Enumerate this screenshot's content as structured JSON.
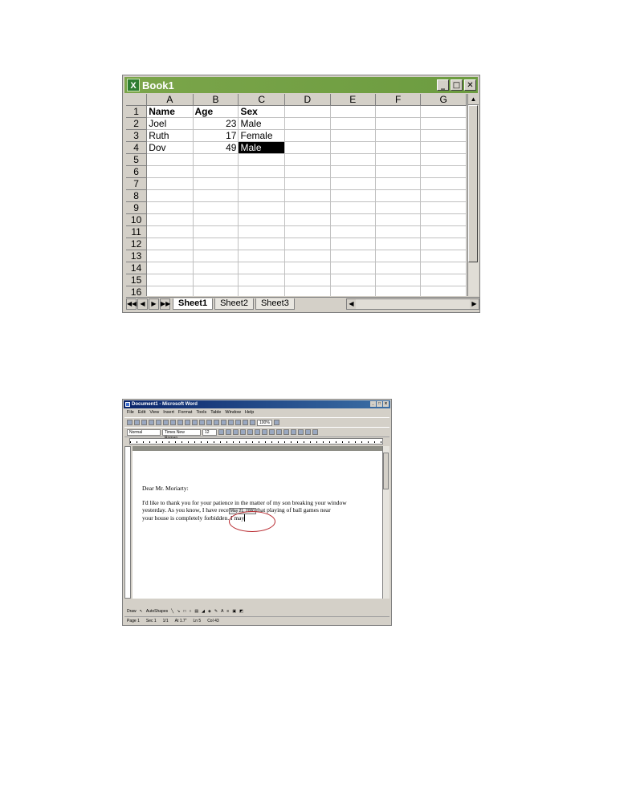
{
  "excel": {
    "title": "Book1",
    "icon": "excel-app-icon",
    "columns": [
      "A",
      "B",
      "C",
      "D",
      "E",
      "F",
      "G"
    ],
    "row_numbers": [
      "1",
      "2",
      "3",
      "4",
      "5",
      "6",
      "7",
      "8",
      "9",
      "10",
      "11",
      "12",
      "13",
      "14",
      "15",
      "16"
    ],
    "rows": [
      [
        "Name",
        "Age",
        "Sex"
      ],
      [
        "Joel",
        "23",
        "Male"
      ],
      [
        "Ruth",
        "17",
        "Female"
      ],
      [
        "Dov",
        "49",
        "Male"
      ]
    ],
    "selected_cell": "C4",
    "sheets": [
      "Sheet1",
      "Sheet2",
      "Sheet3"
    ],
    "active_sheet": "Sheet1"
  },
  "word": {
    "title": "Document1 - Microsoft Word",
    "menu": [
      "File",
      "Edit",
      "View",
      "Insert",
      "Format",
      "Tools",
      "Table",
      "Window",
      "Help"
    ],
    "style": "Normal",
    "font": "Times New Roman",
    "size": "12",
    "zoom": "100%",
    "salutation": "Dear Mr. Moriarty:",
    "body_1": "I'd like to thank you for your patience in the matter of my son breaking your window",
    "body_2a": "yesterday. As you know, I have rece",
    "date_tip": "May 21, 2000",
    "body_2b": "that playing of ball games near",
    "body_3a": "your house is completely forbidden. I may",
    "draw_label": "Draw",
    "autoshapes_label": "AutoShapes",
    "status": [
      "Page 1",
      "Sec 1",
      "1/1",
      "At 1.7\"",
      "Ln 5",
      "Col 43"
    ]
  },
  "colors": {
    "excel_title": "#6c9c40",
    "word_title": "#0a246a",
    "circle": "#b8282e"
  }
}
